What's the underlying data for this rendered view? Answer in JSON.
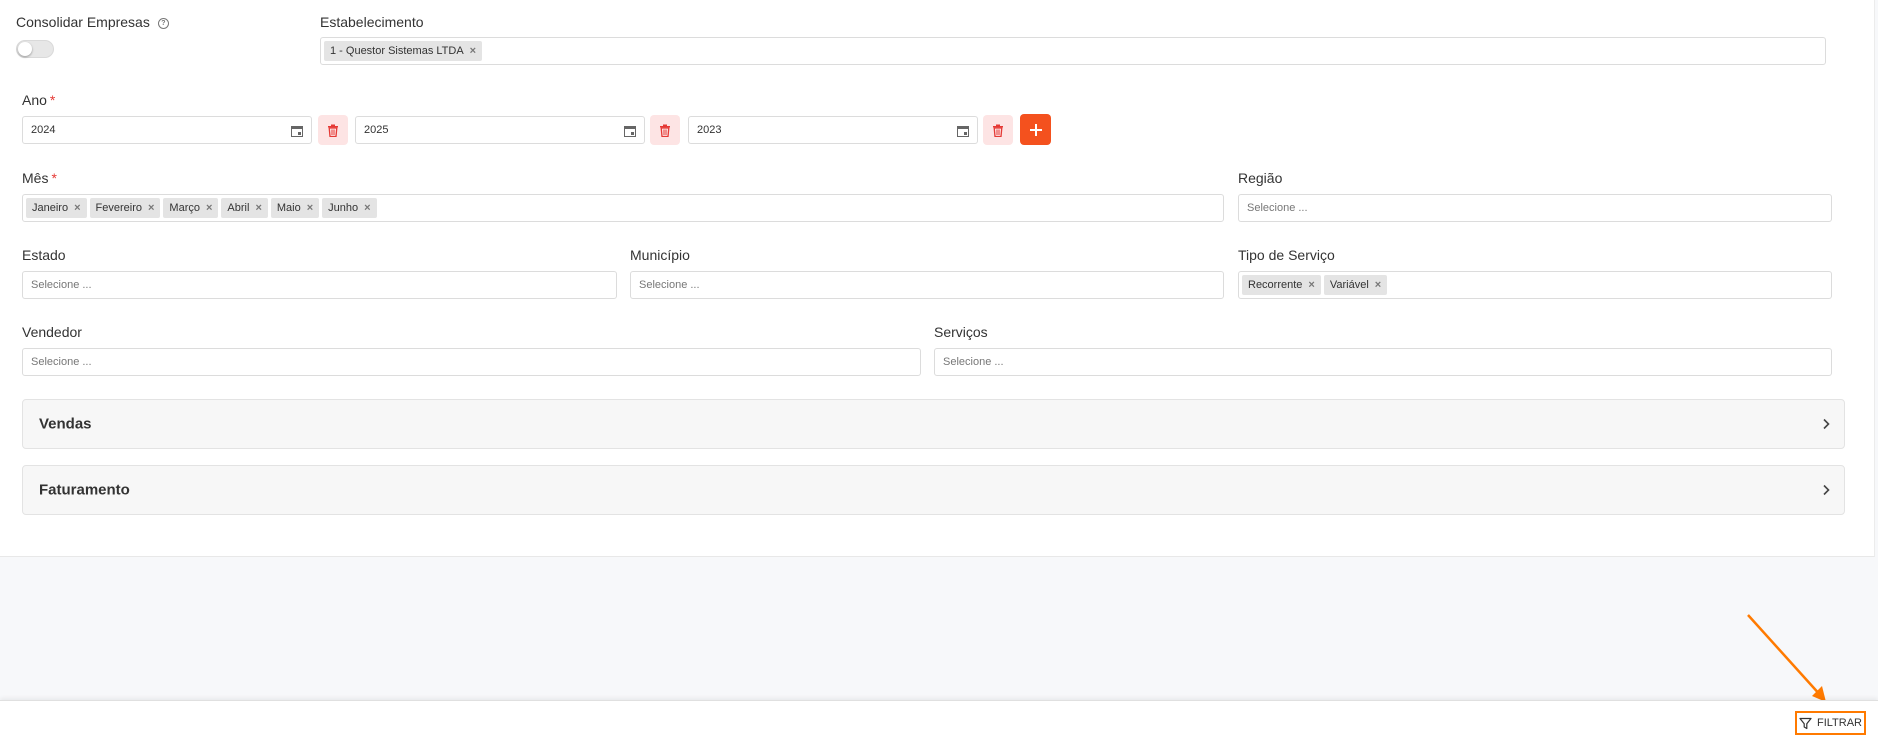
{
  "consolidar": {
    "label": "Consolidar Empresas",
    "help_icon": "help-circle-icon"
  },
  "estabelecimento": {
    "label": "Estabelecimento",
    "chips": [
      "1 - Questor Sistemas LTDA"
    ]
  },
  "ano": {
    "label": "Ano",
    "required_mark": "*",
    "values": [
      "2024",
      "2025",
      "2023"
    ]
  },
  "mes": {
    "label": "Mês",
    "required_mark": "*",
    "chips": [
      "Janeiro",
      "Fevereiro",
      "Março",
      "Abril",
      "Maio",
      "Junho"
    ]
  },
  "regiao": {
    "label": "Região",
    "placeholder": "Selecione ..."
  },
  "estado": {
    "label": "Estado",
    "placeholder": "Selecione ..."
  },
  "municipio": {
    "label": "Município",
    "placeholder": "Selecione ..."
  },
  "tipo_servico": {
    "label": "Tipo de Serviço",
    "chips": [
      "Recorrente",
      "Variável"
    ]
  },
  "vendedor": {
    "label": "Vendedor",
    "placeholder": "Selecione ..."
  },
  "servicos": {
    "label": "Serviços",
    "placeholder": "Selecione ..."
  },
  "accordions": [
    {
      "title": "Vendas"
    },
    {
      "title": "Faturamento"
    }
  ],
  "footer": {
    "filter_label": "FILTRAR"
  },
  "colors": {
    "accent": "#f4511e",
    "highlight": "#ff7a00",
    "danger_bg": "#fde4e4",
    "danger_icon": "#e53935"
  }
}
